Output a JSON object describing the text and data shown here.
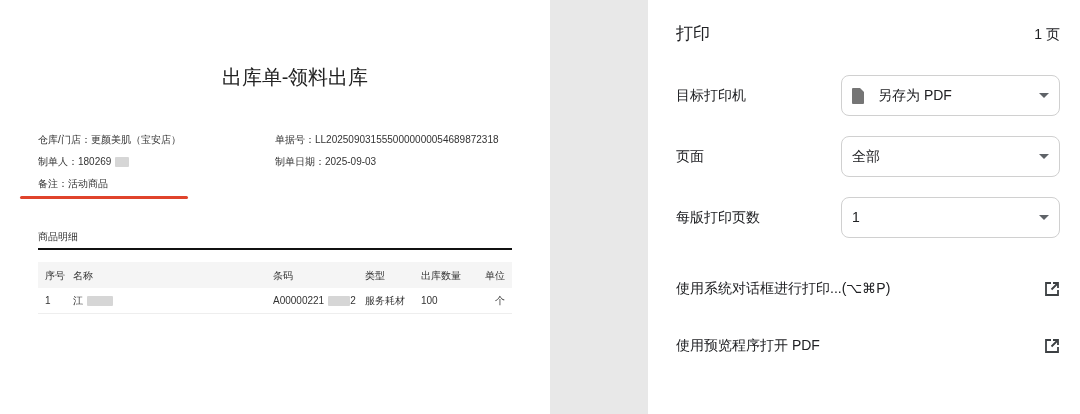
{
  "document": {
    "title": "出库单-领料出库",
    "fields_left": [
      {
        "label": "仓库/门店：",
        "value": "更颜美肌（宝安店）",
        "kind": "plain"
      },
      {
        "label": "制单人：",
        "value": "180269",
        "kind": "redacted"
      },
      {
        "label": "备注：",
        "value": "活动商品",
        "kind": "underlined"
      }
    ],
    "fields_right": [
      {
        "label": "单据号：",
        "value": "LL2025090315550000000054689872318"
      },
      {
        "label": "制单日期：",
        "value": "2025-09-03"
      }
    ],
    "section_title": "商品明细",
    "table": {
      "columns": [
        "序号",
        "名称",
        "条码",
        "类型",
        "出库数量",
        "单位"
      ],
      "rows": [
        {
          "index": "1",
          "name": "江",
          "barcode_start": "A00000221",
          "barcode_end": "2",
          "type": "服务耗材",
          "quantity": "100",
          "unit": "个"
        }
      ]
    }
  },
  "print_panel": {
    "title": "打印",
    "page_count": "1 页",
    "settings": [
      {
        "label": "目标打印机",
        "value": "另存为 PDF",
        "kind": "file"
      },
      {
        "label": "页面",
        "value": "全部",
        "kind": "plain"
      },
      {
        "label": "每版打印页数",
        "value": "1",
        "kind": "plain"
      }
    ],
    "links": [
      "使用系统对话框进行打印...(⌥⌘P)",
      "使用预览程序打开 PDF"
    ]
  }
}
